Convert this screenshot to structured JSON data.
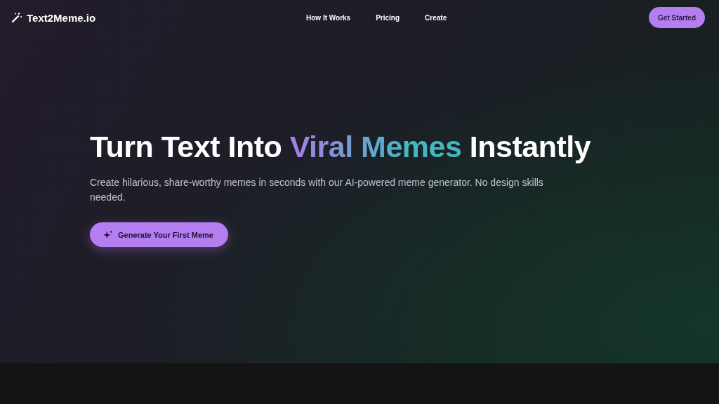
{
  "brand": "Text2Meme.io",
  "nav": [
    "How It Works",
    "Pricing",
    "Create"
  ],
  "cta": "Get Started",
  "hero": {
    "heading_start": "Turn Text Into ",
    "heading_highlight": "Viral Memes",
    "heading_end": " Instantly",
    "subtitle": "Create hilarious, share-worthy memes in seconds with our AI-powered meme generator. No design skills needed.",
    "button": "Generate Your First Meme"
  }
}
